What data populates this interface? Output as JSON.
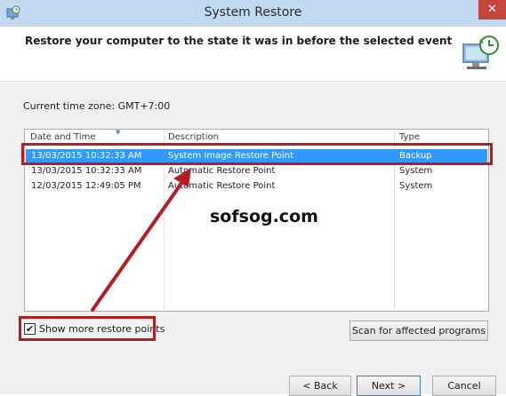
{
  "window": {
    "title": "System Restore",
    "close_symbol": "✕"
  },
  "header": {
    "instruction": "Restore your computer to the state it was in before the selected event"
  },
  "timezone": {
    "label": "Current time zone: GMT+7:00"
  },
  "table": {
    "columns": [
      "Date and Time",
      "Description",
      "Type"
    ],
    "rows": [
      {
        "date": "13/03/2015 10:32:33 AM",
        "description": "System Image Restore Point",
        "type": "Backup",
        "selected": true
      },
      {
        "date": "13/03/2015 10:32:33 AM",
        "description": "Automatic Restore Point",
        "type": "System",
        "selected": false
      },
      {
        "date": "12/03/2015 12:49:05 PM",
        "description": "Automatic Restore Point",
        "type": "System",
        "selected": false
      }
    ]
  },
  "show_more": {
    "label": "Show more restore points",
    "checked": true
  },
  "buttons": {
    "scan": "Scan for affected programs",
    "back": "< Back",
    "next": "Next >",
    "cancel": "Cancel"
  },
  "watermark": "sofsog.com",
  "colors": {
    "titlebar": "#c2daf1",
    "selection": "#3399ff",
    "annotation": "#b61c22",
    "close_button": "#c7463c"
  },
  "icons": {
    "title": "system-restore-icon",
    "header": "computer-restore-icon",
    "close": "close-icon",
    "checkbox": "checkmark-icon"
  }
}
